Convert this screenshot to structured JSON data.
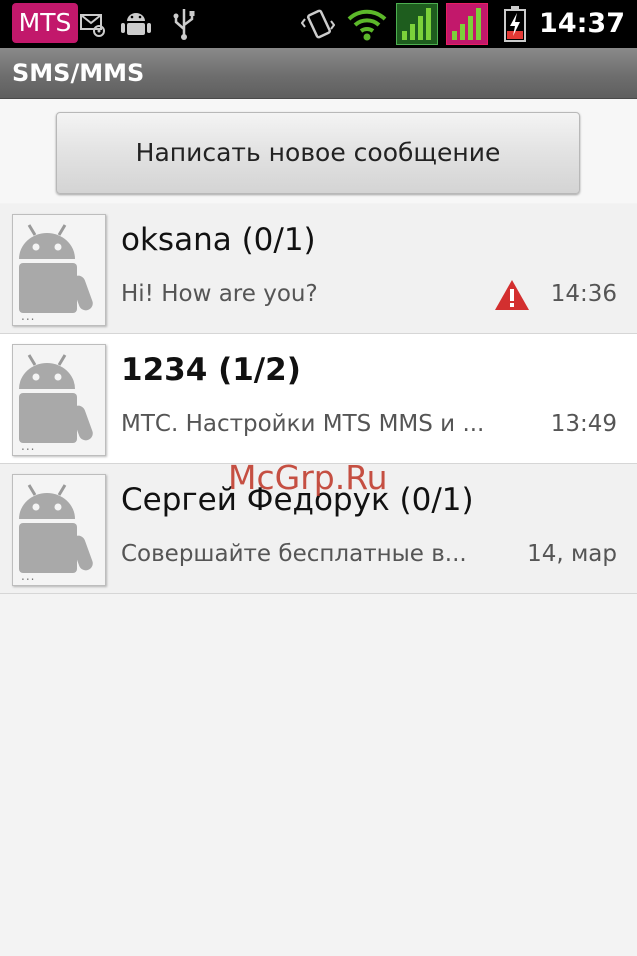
{
  "status_bar": {
    "carrier": "MTS",
    "time": "14:37",
    "icons": [
      "message-settings-icon",
      "android-debug-icon",
      "usb-icon",
      "vibrate-icon",
      "wifi-icon",
      "signal-sim1-icon",
      "signal-sim2-icon",
      "battery-charging-icon"
    ]
  },
  "title_bar": {
    "title": "SMS/MMS"
  },
  "compose": {
    "label": "Написать новое сообщение"
  },
  "conversations": [
    {
      "name": "oksana (0/1)",
      "snippet": "Hi! How are you?",
      "date": "14:36",
      "unread": false,
      "error": true
    },
    {
      "name": "1234 (1/2)",
      "snippet": "МТС. Настройки MTS MMS и ...",
      "date": "13:49",
      "unread": true,
      "error": false
    },
    {
      "name": "Сергей Федорук (0/1)",
      "snippet": "Совершайте бесплатные в...",
      "date": "14, мар",
      "unread": false,
      "error": false
    }
  ],
  "avatar_overlay": "...",
  "watermark": "McGrp.Ru",
  "colors": {
    "carrier_bg": "#c2186b",
    "error": "#d32f2f",
    "title_bar": "#6e6e6e"
  }
}
